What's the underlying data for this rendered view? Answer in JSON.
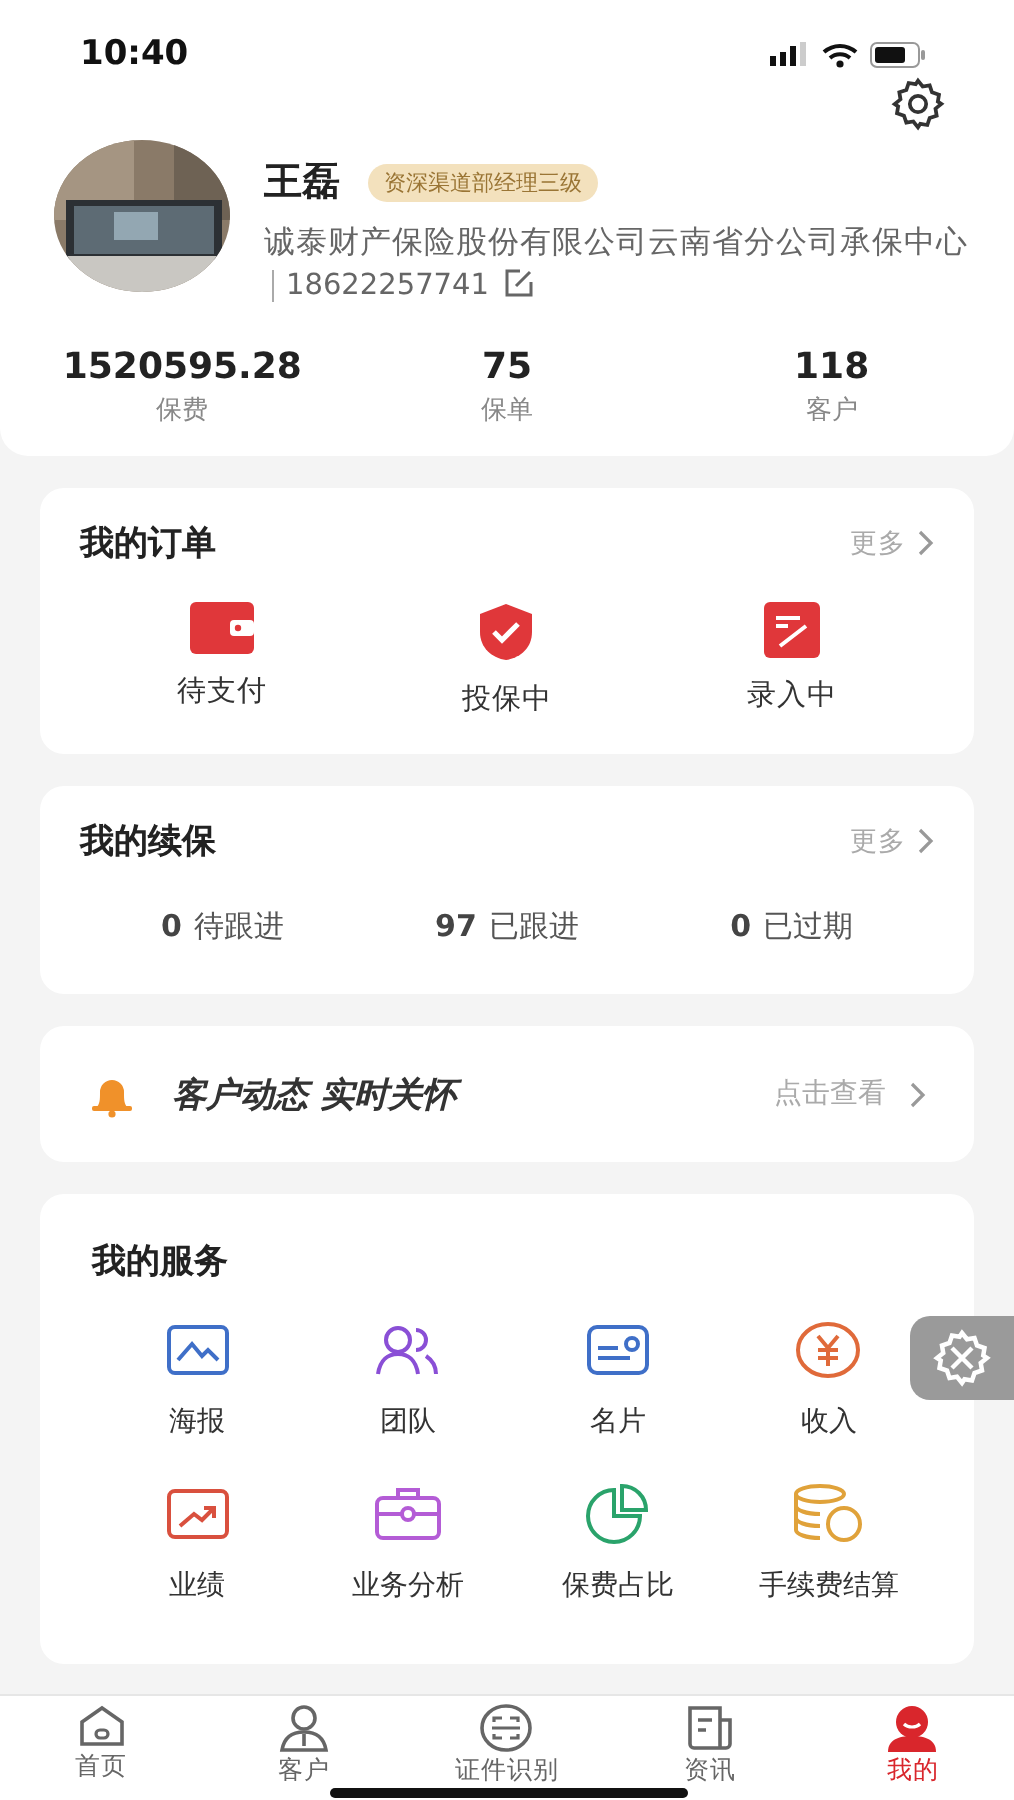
{
  "status_bar": {
    "time": "10:40"
  },
  "profile": {
    "name": "王磊",
    "badge": "资深渠道部经理三级",
    "company": "诚泰财产保险股份有限公司云南省分公司承保中心",
    "phone": "18622257741"
  },
  "stats": [
    {
      "value": "1520595.28",
      "label": "保费"
    },
    {
      "value": "75",
      "label": "保单"
    },
    {
      "value": "118",
      "label": "客户"
    }
  ],
  "orders": {
    "title": "我的订单",
    "more": "更多",
    "items": [
      {
        "label": "待支付"
      },
      {
        "label": "投保中"
      },
      {
        "label": "录入中"
      }
    ]
  },
  "renewal": {
    "title": "我的续保",
    "more": "更多",
    "items": [
      {
        "count": "0",
        "label": "待跟进"
      },
      {
        "count": "97",
        "label": "已跟进"
      },
      {
        "count": "0",
        "label": "已过期"
      }
    ]
  },
  "notice": {
    "text": "客户动态 实时关怀",
    "action": "点击查看"
  },
  "services": {
    "title": "我的服务",
    "items": [
      {
        "label": "海报"
      },
      {
        "label": "团队"
      },
      {
        "label": "名片"
      },
      {
        "label": "收入"
      },
      {
        "label": "业绩"
      },
      {
        "label": "业务分析"
      },
      {
        "label": "保费占比"
      },
      {
        "label": "手续费结算"
      }
    ]
  },
  "tab_bar": [
    {
      "label": "首页",
      "selected": false
    },
    {
      "label": "客户",
      "selected": false
    },
    {
      "label": "证件识别",
      "selected": false
    },
    {
      "label": "资讯",
      "selected": false
    },
    {
      "label": "我的",
      "selected": true
    }
  ]
}
